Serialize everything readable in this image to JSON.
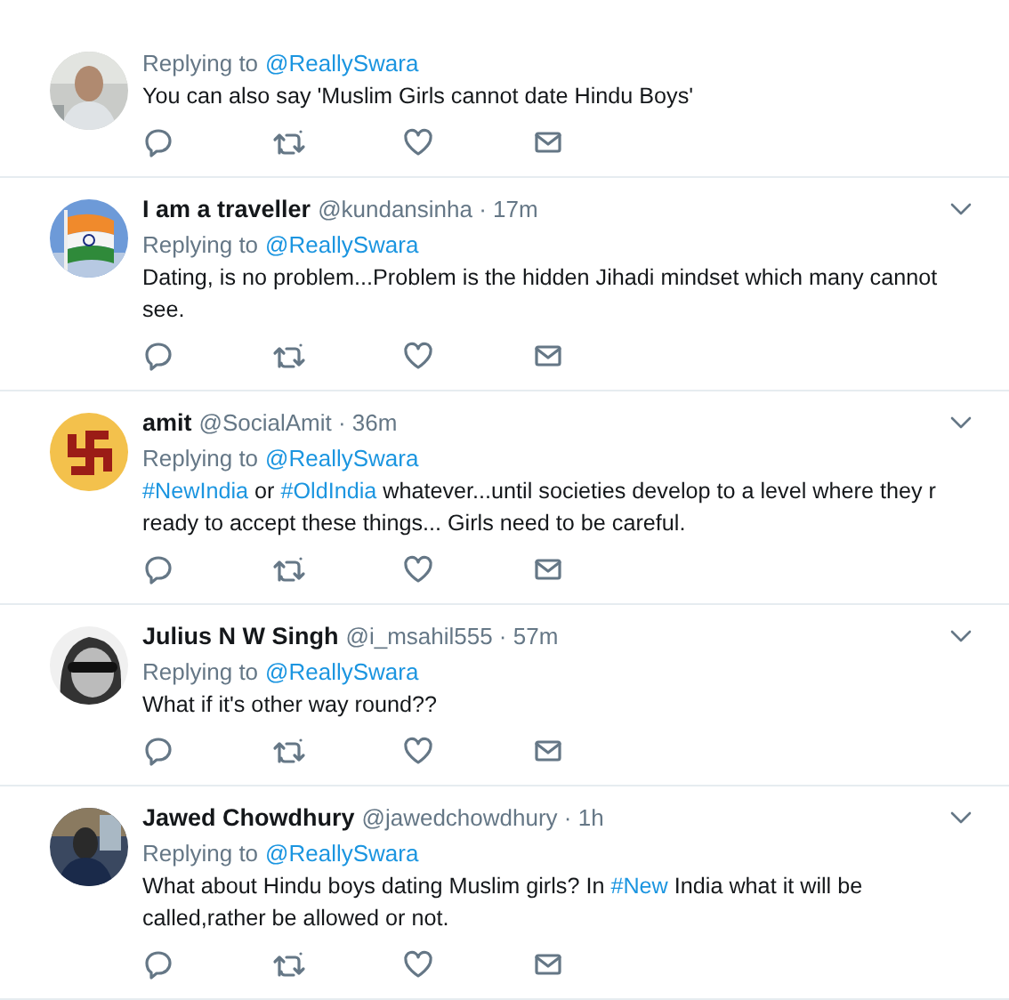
{
  "tweets": [
    {
      "avatar": {
        "kind": "picture"
      },
      "replying_label": "Replying to",
      "replying_handle": "@ReallySwara",
      "text": [
        {
          "kind": "plain",
          "text": "You can also say 'Muslim Girls cannot date Hindu Boys'"
        }
      ]
    },
    {
      "name": "I am a traveller",
      "meta": "@kundansinha · 17m",
      "avatar": {
        "kind": "picture"
      },
      "replying_label": "Replying to",
      "replying_handle": "@ReallySwara",
      "text": [
        {
          "kind": "plain",
          "text": "Dating, is no problem...Problem is the hidden Jihadi mindset which many cannot see."
        }
      ]
    },
    {
      "name": "amit",
      "meta": "@SocialAmit · 36m",
      "avatar": {
        "kind": "picture"
      },
      "replying_label": "Replying to",
      "replying_handle": "@ReallySwara",
      "text": [
        {
          "kind": "hashtag",
          "text": "#NewIndia"
        },
        {
          "kind": "plain",
          "text": " or "
        },
        {
          "kind": "hashtag",
          "text": "#OldIndia"
        },
        {
          "kind": "plain",
          "text": " whatever...until societies develop to a level where they r ready to accept these things... Girls need to be careful."
        }
      ]
    },
    {
      "name": "Julius N W Singh",
      "meta": "@i_msahil555 · 57m",
      "avatar": {
        "kind": "picture"
      },
      "replying_label": "Replying to",
      "replying_handle": "@ReallySwara",
      "text": [
        {
          "kind": "plain",
          "text": "What if it's other way round??"
        }
      ]
    },
    {
      "name": "Jawed Chowdhury",
      "meta": "@jawedchowdhury · 1h",
      "avatar": {
        "kind": "picture"
      },
      "replying_label": "Replying to",
      "replying_handle": "@ReallySwara",
      "text": [
        {
          "kind": "plain",
          "text": "What about Hindu boys dating Muslim girls? In "
        },
        {
          "kind": "hashtag",
          "text": "#New"
        },
        {
          "kind": "plain",
          "text": " India what it will be called,rather be allowed or not."
        }
      ]
    }
  ]
}
